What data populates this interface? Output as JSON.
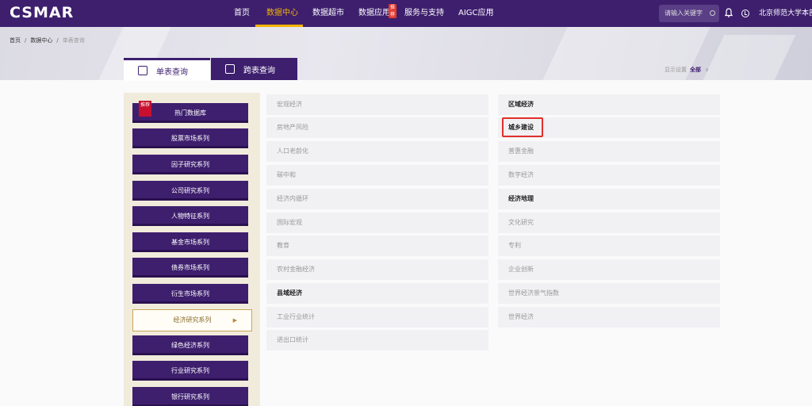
{
  "app": {
    "logo": "CSMAR"
  },
  "nav": {
    "items": [
      "首页",
      "数据中心",
      "数据超市",
      "数据应用",
      "服务与支持",
      "AIGC应用"
    ],
    "active_index": 1,
    "badge": "推荐"
  },
  "header": {
    "search_placeholder": "请输入关键字",
    "user": "北京师范大学本部"
  },
  "breadcrumb": [
    "首页",
    "数据中心",
    "单表查询"
  ],
  "tabs": [
    "单表查询",
    "跨表查询"
  ],
  "display_setting": {
    "label": "显示设置",
    "value": "全部",
    "chevron": "∨"
  },
  "left_series": {
    "hot_badge": "推荐",
    "items": [
      "热门数据库",
      "股票市场系列",
      "因子研究系列",
      "公司研究系列",
      "人物特征系列",
      "基金市场系列",
      "债券市场系列",
      "衍生市场系列",
      "经济研究系列",
      "绿色经济系列",
      "行业研究系列",
      "银行研究系列"
    ],
    "active_index": 8,
    "active_arrow": "▶"
  },
  "grid": {
    "left_col": [
      "宏观经济",
      "房地产风险",
      "人口老龄化",
      "碳中和",
      "经济内循环",
      "国际宏观",
      "教育",
      "农村金融经济",
      "县域经济",
      "工业行业统计",
      "进出口统计"
    ],
    "right_col": [
      "区域经济",
      "城乡建设",
      "普惠金融",
      "数字经济",
      "经济地理",
      "文化研究",
      "专利",
      "企业创新",
      "世界经济景气指数",
      "世界经济"
    ],
    "bold_left": [
      8
    ],
    "bold_right": [
      0,
      1,
      4
    ],
    "highlighted": "城乡建设"
  },
  "colors": {
    "brand": "#3e1f6e",
    "accent": "#f0b400",
    "highlight": "#e0302a"
  }
}
